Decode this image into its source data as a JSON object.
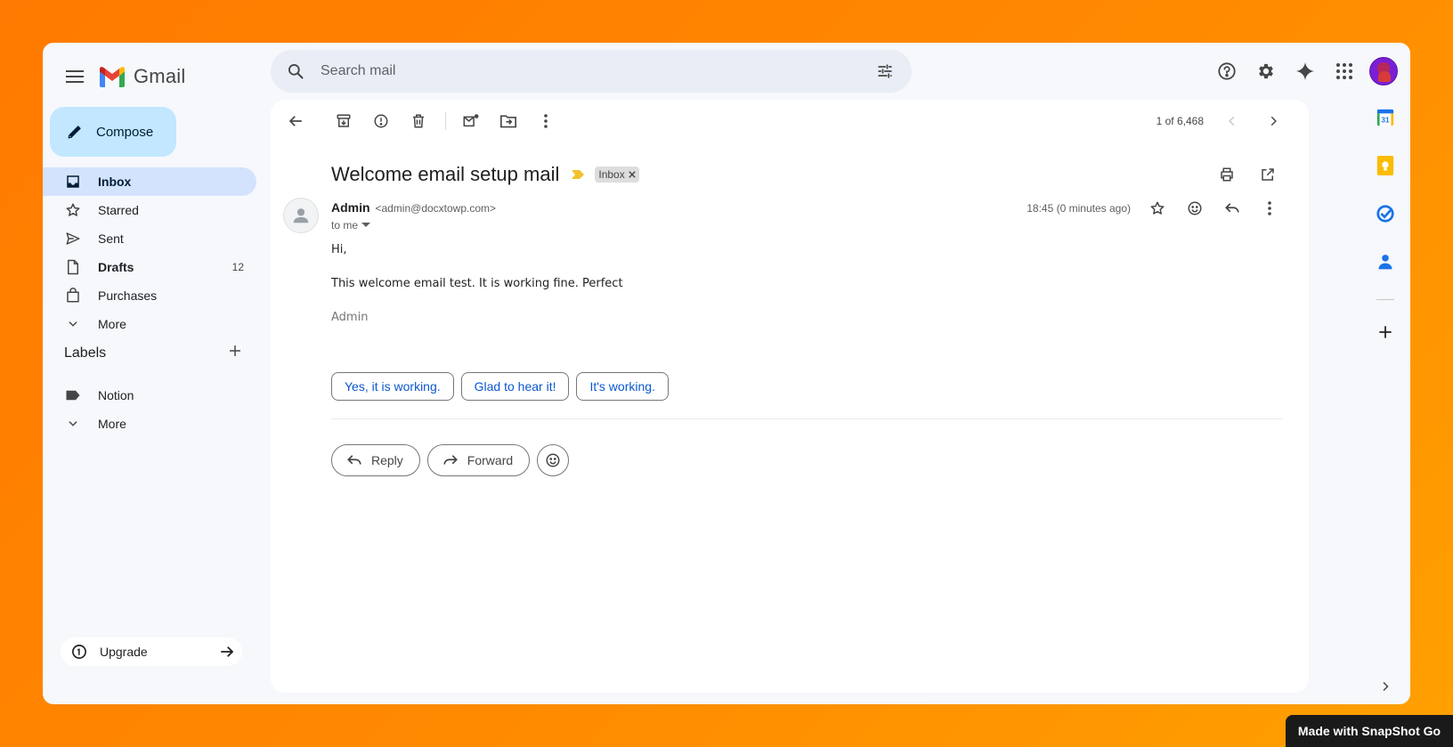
{
  "app": {
    "name": "Gmail"
  },
  "search": {
    "placeholder": "Search mail"
  },
  "compose": {
    "label": "Compose"
  },
  "sidebar": {
    "items": [
      {
        "label": "Inbox",
        "icon": "inbox-icon",
        "count": ""
      },
      {
        "label": "Starred",
        "icon": "star-icon",
        "count": ""
      },
      {
        "label": "Sent",
        "icon": "send-icon",
        "count": ""
      },
      {
        "label": "Drafts",
        "icon": "draft-icon",
        "count": "12"
      },
      {
        "label": "Purchases",
        "icon": "shopping-bag-icon",
        "count": ""
      },
      {
        "label": "More",
        "icon": "chevron-down-icon",
        "count": ""
      }
    ],
    "labels_title": "Labels",
    "labels": [
      {
        "label": "Notion",
        "icon": "label-icon"
      },
      {
        "label": "More",
        "icon": "chevron-down-icon"
      }
    ],
    "upgrade_label": "Upgrade"
  },
  "toolbar": {
    "pager_text": "1 of 6,468"
  },
  "message": {
    "subject": "Welcome email setup mail",
    "label_chip": "Inbox",
    "sender_name": "Admin",
    "sender_email": "<admin@docxtowp.com>",
    "to_text": "to me",
    "timestamp": "18:45 (0 minutes ago)",
    "body": {
      "greeting": "Hi,",
      "line1": "This welcome email test. It is working fine. Perfect",
      "signature": "Admin"
    }
  },
  "smart_replies": [
    "Yes, it is working.",
    "Glad to hear it!",
    "It's working."
  ],
  "actions": {
    "reply_label": "Reply",
    "forward_label": "Forward"
  },
  "colors": {
    "accent": "#0b57d0",
    "compose_bg": "#c2e7ff",
    "active_nav_bg": "#d3e3fd",
    "background_gradient_start": "#ff7a00",
    "background_gradient_end": "#ffa000"
  },
  "watermark": {
    "text": "Made with SnapShot Go"
  }
}
